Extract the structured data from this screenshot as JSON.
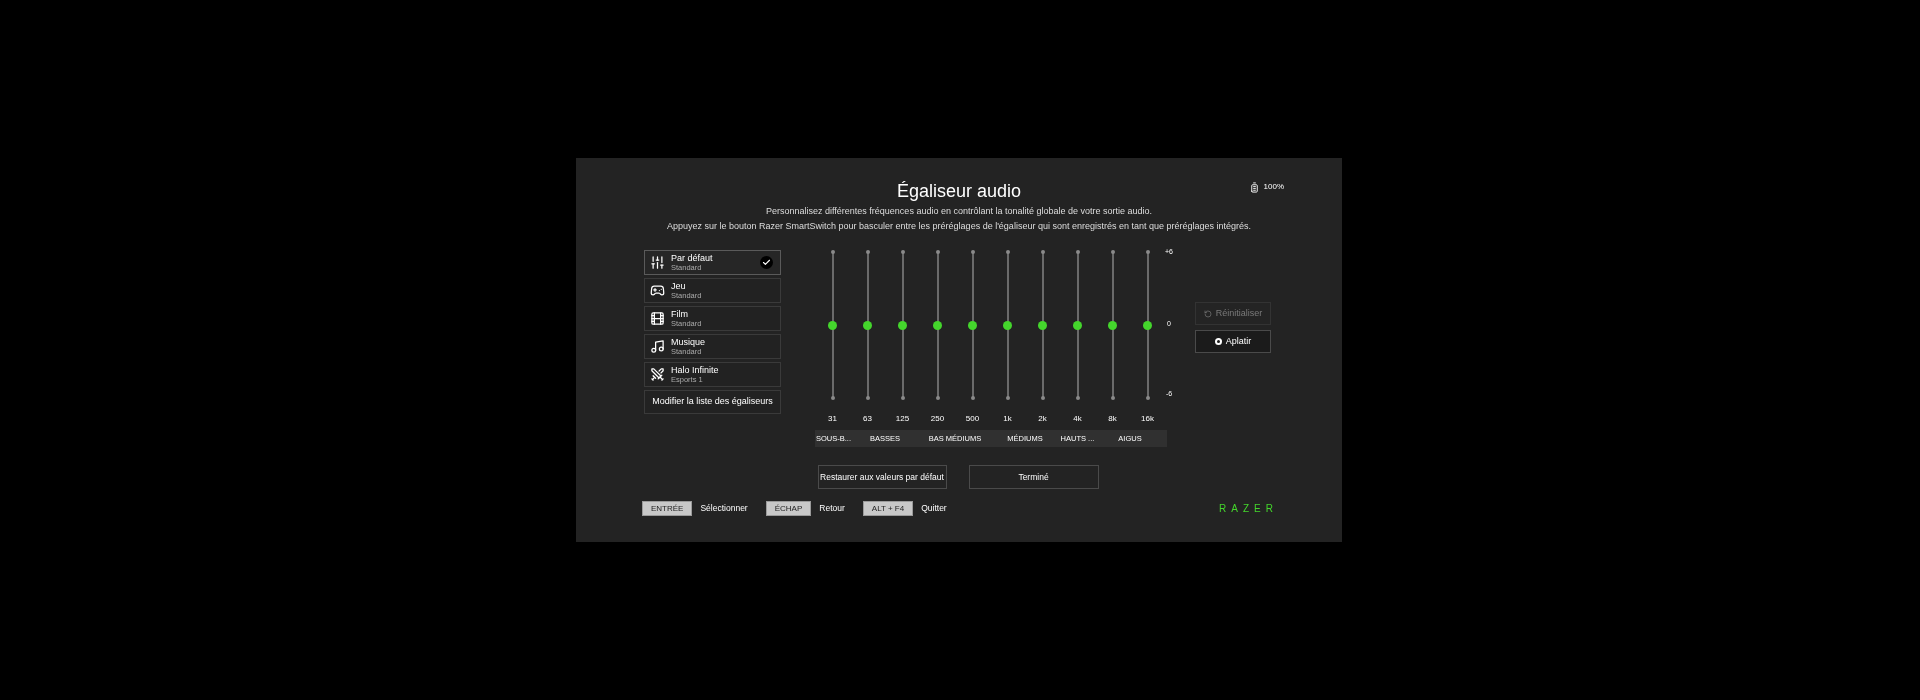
{
  "header": {
    "title": "Égaliseur audio",
    "battery": "100%",
    "description": [
      "Personnalisez différentes fréquences audio en contrôlant la tonalité globale de votre sortie audio.",
      "Appuyez sur le bouton Razer SmartSwitch pour basculer entre les préréglages de l'égaliseur qui sont enregistrés en tant que préréglages intégrés."
    ]
  },
  "presets": [
    {
      "kind": "sliders",
      "name": "Par défaut",
      "subtitle": "Standard",
      "selected": true
    },
    {
      "kind": "gamepad",
      "name": "Jeu",
      "subtitle": "Standard",
      "selected": false
    },
    {
      "kind": "film",
      "name": "Film",
      "subtitle": "Standard",
      "selected": false
    },
    {
      "kind": "music",
      "name": "Musique",
      "subtitle": "Standard",
      "selected": false
    },
    {
      "kind": "swords",
      "name": "Halo Infinite",
      "subtitle": "Esports 1",
      "selected": false
    }
  ],
  "edit_list_button": "Modifier la liste des égaliseurs",
  "scale": {
    "max": "+6",
    "mid": "0",
    "min": "-6"
  },
  "band_groups": [
    {
      "label": "SOUS-B...",
      "bands": [
        {
          "freq": "31",
          "level": 0.5
        }
      ]
    },
    {
      "label": "BASSES",
      "bands": [
        {
          "freq": "63",
          "level": 0.5
        },
        {
          "freq": "125",
          "level": 0.5
        }
      ]
    },
    {
      "label": "BAS MÉDIUMS",
      "bands": [
        {
          "freq": "250",
          "level": 0.5
        },
        {
          "freq": "500",
          "level": 0.5
        }
      ]
    },
    {
      "label": "MÉDIUMS",
      "bands": [
        {
          "freq": "1k",
          "level": 0.5
        },
        {
          "freq": "2k",
          "level": 0.5
        }
      ]
    },
    {
      "label": "HAUTS ...",
      "bands": [
        {
          "freq": "4k",
          "level": 0.5
        }
      ]
    },
    {
      "label": "AIGUS",
      "bands": [
        {
          "freq": "8k",
          "level": 0.5
        },
        {
          "freq": "16k",
          "level": 0.5
        }
      ]
    }
  ],
  "reset_button": {
    "label": "Réinitialiser",
    "disabled": true
  },
  "flatten_button": {
    "label": "Aplatir",
    "disabled": false
  },
  "restore_button": "Restaurer aux valeurs par défaut",
  "done_button": "Terminé",
  "shortcuts": [
    {
      "key": "ENTRÉE",
      "action": "Sélectionner"
    },
    {
      "key": "ÉCHAP",
      "action": "Retour"
    },
    {
      "key": "ALT + F4",
      "action": "Quitter"
    }
  ],
  "logo": "RAZER"
}
